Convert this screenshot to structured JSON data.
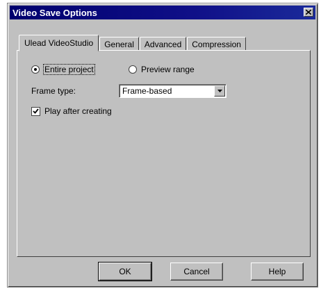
{
  "window": {
    "title": "Video Save Options",
    "close_icon": "close-icon"
  },
  "tabs": [
    {
      "label": "Ulead VideoStudio",
      "active": true
    },
    {
      "label": "General",
      "active": false
    },
    {
      "label": "Advanced",
      "active": false
    },
    {
      "label": "Compression",
      "active": false
    }
  ],
  "options": {
    "entire_project": {
      "label": "Entire project",
      "selected": true
    },
    "preview_range": {
      "label": "Preview range",
      "selected": false
    },
    "frame_type_label": "Frame type:",
    "frame_type_value": "Frame-based",
    "play_after": {
      "label": "Play after creating",
      "checked": true
    }
  },
  "buttons": {
    "ok": "OK",
    "cancel": "Cancel",
    "help": "Help"
  }
}
